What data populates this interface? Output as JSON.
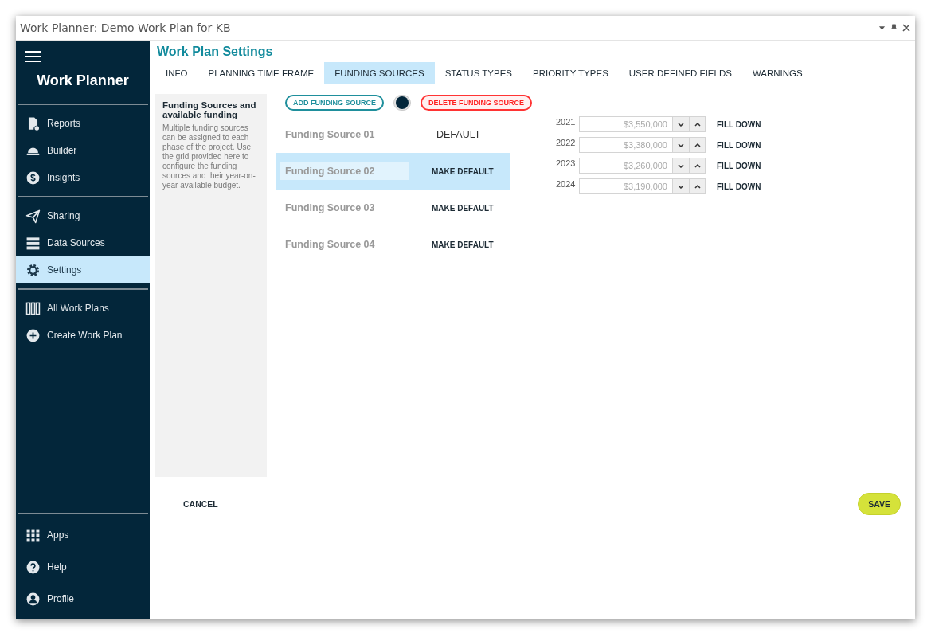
{
  "window": {
    "title": "Work Planner: Demo Work Plan for KB"
  },
  "sidebar": {
    "app_name": "Work Planner",
    "groups": [
      [
        {
          "label": "Reports",
          "selected": false
        },
        {
          "label": "Builder",
          "selected": false
        },
        {
          "label": "Insights",
          "selected": false
        }
      ],
      [
        {
          "label": "Sharing",
          "selected": false
        },
        {
          "label": "Data Sources",
          "selected": false
        },
        {
          "label": "Settings",
          "selected": true
        }
      ],
      [
        {
          "label": "All Work Plans",
          "selected": false
        },
        {
          "label": "Create Work Plan",
          "selected": false
        }
      ]
    ],
    "bottom_items": [
      {
        "label": "Apps",
        "selected": false
      },
      {
        "label": "Help",
        "selected": false
      },
      {
        "label": "Profile",
        "selected": false
      }
    ]
  },
  "page_title": "Work Plan Settings",
  "tabs": [
    {
      "label": "INFO",
      "selected": false
    },
    {
      "label": "PLANNING TIME FRAME",
      "selected": false
    },
    {
      "label": "FUNDING SOURCES",
      "selected": true
    },
    {
      "label": "STATUS TYPES",
      "selected": false
    },
    {
      "label": "PRIORITY TYPES",
      "selected": false
    },
    {
      "label": "USER DEFINED FIELDS",
      "selected": false
    },
    {
      "label": "WARNINGS",
      "selected": false
    }
  ],
  "description": {
    "heading": "Funding Sources and available funding",
    "text": "Multiple funding sources can be assigned to each phase of the project. Use the grid provided here to configure the funding sources and their year-on-year available budget."
  },
  "add_button": "ADD FUNDING SOURCE",
  "toggle": {
    "on": false
  },
  "delete_button": "DELETE FUNDING SOURCE",
  "funding_sources": [
    {
      "name": "Funding Source 01",
      "action": "DEFAULT",
      "is_default": true,
      "selected": false
    },
    {
      "name": "Funding Source 02",
      "action": "MAKE DEFAULT",
      "is_default": false,
      "selected": true
    },
    {
      "name": "Funding Source 03",
      "action": "MAKE DEFAULT",
      "is_default": false,
      "selected": false
    },
    {
      "name": "Funding Source 04",
      "action": "MAKE DEFAULT",
      "is_default": false,
      "selected": false
    }
  ],
  "budget": [
    {
      "year": "2021",
      "value": "$3,550,000",
      "fill": "FILL DOWN"
    },
    {
      "year": "2022",
      "value": "$3,380,000",
      "fill": "FILL DOWN"
    },
    {
      "year": "2023",
      "value": "$3,260,000",
      "fill": "FILL DOWN"
    },
    {
      "year": "2024",
      "value": "$3,190,000",
      "fill": "FILL DOWN"
    }
  ],
  "cancel_button": "CANCEL",
  "save_button": "SAVE"
}
